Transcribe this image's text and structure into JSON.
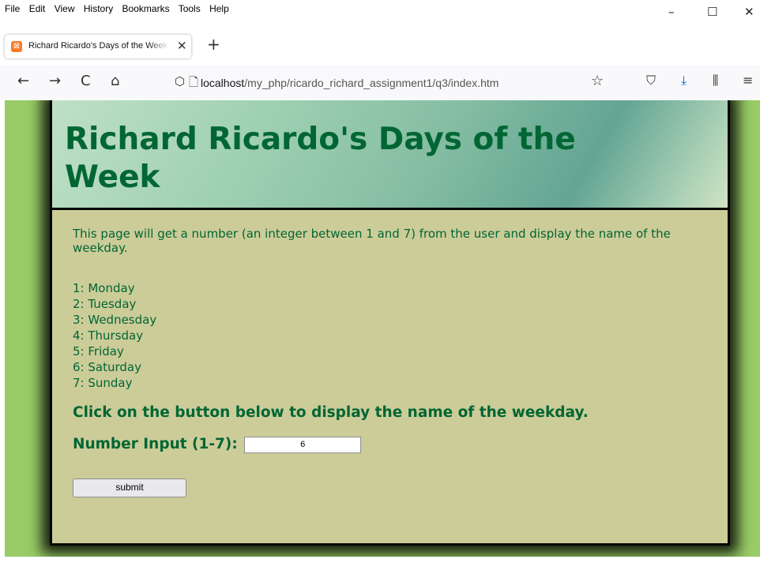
{
  "menubar": {
    "items": [
      "File",
      "Edit",
      "View",
      "History",
      "Bookmarks",
      "Tools",
      "Help"
    ]
  },
  "window_controls": {
    "minimize": "–",
    "maximize": "☐",
    "close": "✕"
  },
  "tab": {
    "title": "Richard Ricardo's Days of the Week",
    "close": "✕",
    "new_tab": "+"
  },
  "nav": {
    "back": "←",
    "forward": "→",
    "reload": "C",
    "home": "⌂",
    "url_host": "localhost",
    "url_path": "/my_php/ricardo_richard_assignment1/q3/index.htm",
    "bookmark_star": "☆"
  },
  "page": {
    "title": "Richard Ricardo's Days of the Week",
    "intro": "This page will get a number (an integer between 1 and 7) from the user and display the name of the weekday.",
    "days": [
      "1: Monday",
      "2: Tuesday",
      "3: Wednesday",
      "4: Thursday",
      "5: Friday",
      "6: Saturday",
      "7: Sunday"
    ],
    "instruction": "Click on the button below to display the name of the weekday.",
    "input_label": "Number Input (1-7):",
    "input_value": "6",
    "submit_label": "submit"
  },
  "colors": {
    "page_background": "#99cc66",
    "content_background": "#cccc99",
    "text": "#006633"
  }
}
